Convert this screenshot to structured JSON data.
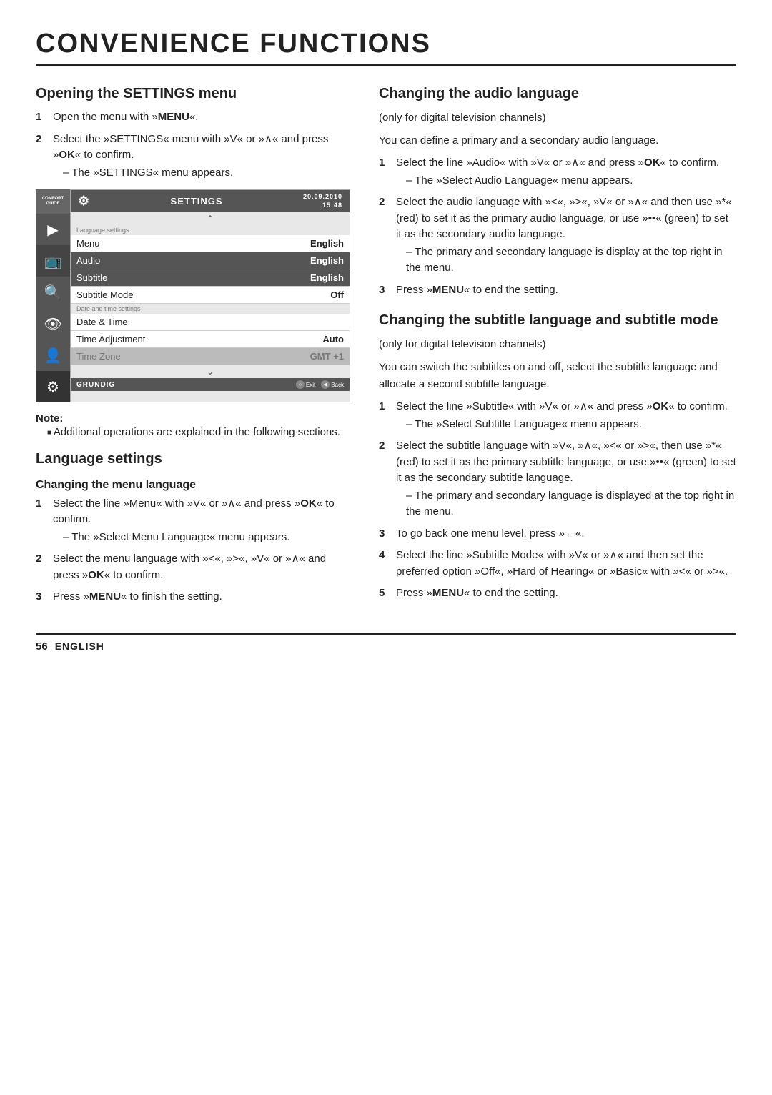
{
  "page": {
    "title": "CONVENIENCE FUNCTIONS",
    "footer": {
      "page_number": "56",
      "language": "ENGLISH"
    }
  },
  "left_column": {
    "opening_settings": {
      "title": "Opening the SETTINGS menu",
      "steps": [
        {
          "num": "1",
          "text": "Open the menu with »MENU«."
        },
        {
          "num": "2",
          "text": "Select the »SETTINGS« menu with »V« or »∧« and press »OK« to confirm.",
          "sub": "– The »SETTINGS« menu appears."
        }
      ]
    },
    "menu_sim": {
      "header_title": "SETTINGS",
      "date": "20.09.2010",
      "time": "15:48",
      "section_language": "Language settings",
      "rows_language": [
        {
          "label": "Menu",
          "value": "English",
          "highlighted": false
        },
        {
          "label": "Audio",
          "value": "English",
          "highlighted": true
        },
        {
          "label": "Subtitle",
          "value": "English",
          "highlighted": true
        },
        {
          "label": "Subtitle Mode",
          "value": "Off",
          "highlighted": false
        }
      ],
      "section_datetime": "Date and time settings",
      "rows_datetime": [
        {
          "label": "Date & Time",
          "value": "",
          "highlighted": false
        },
        {
          "label": "Time Adjustment",
          "value": "Auto",
          "highlighted": false
        },
        {
          "label": "Time Zone",
          "value": "GMT +1",
          "highlighted": false
        }
      ],
      "footer_logo": "GRUNDIG",
      "footer_exit": "Exit",
      "footer_back": "Back"
    },
    "note": {
      "title": "Note:",
      "items": [
        "Additional operations are explained in the following sections."
      ]
    },
    "language_settings": {
      "title": "Language settings"
    },
    "changing_menu": {
      "title": "Changing the menu language",
      "steps": [
        {
          "num": "1",
          "text": "Select the line »Menu« with »V« or »∧« and press »OK« to confirm.",
          "sub": "– The »Select Menu Language« menu appears."
        },
        {
          "num": "2",
          "text": "Select the menu language with »<«, »>«, »V« or »∧« and press »OK« to confirm."
        },
        {
          "num": "3",
          "text": "Press »MENU« to finish the setting."
        }
      ]
    }
  },
  "right_column": {
    "changing_audio": {
      "title": "Changing the audio language",
      "subtitle_note": "(only for digital television channels)",
      "intro": "You can define a primary and a secondary audio language.",
      "steps": [
        {
          "num": "1",
          "text": "Select the line »Audio« with »V« or »∧« and press »OK« to confirm.",
          "sub": "– The »Select Audio Language« menu appears."
        },
        {
          "num": "2",
          "text": "Select the audio language with »<«, »>«, »V« or »∧« and then use »*« (red) to set it as the primary audio language, or use »••«  (green) to set it as the secondary audio language.",
          "sub": "– The primary and secondary language is display at the top right in the menu."
        },
        {
          "num": "3",
          "text": "Press »MENU« to end the setting."
        }
      ]
    },
    "changing_subtitle": {
      "title": "Changing the subtitle language and subtitle mode",
      "subtitle_note": "(only for digital television channels)",
      "intro": "You can switch the subtitles on and off, select the subtitle language and allocate a second subtitle language.",
      "steps": [
        {
          "num": "1",
          "text": "Select the line »Subtitle« with »V« or »∧« and press »OK« to confirm.",
          "sub": "– The »Select Subtitle Language« menu appears."
        },
        {
          "num": "2",
          "text": "Select the subtitle language with »V«, »∧«, »<« or »>«, then use »*« (red) to set it as the primary subtitle language, or use »••« (green) to set it as the secondary subtitle language.",
          "sub": "– The primary and secondary language is displayed at the top right in the menu."
        },
        {
          "num": "3",
          "text": "To go back one menu level, press »←«."
        },
        {
          "num": "4",
          "text": "Select the line »Subtitle Mode« with »V« or »∧« and then set the preferred option »Off«, »Hard of Hearing« or »Basic« with »<« or »>«."
        },
        {
          "num": "5",
          "text": "Press »MENU« to end the setting."
        }
      ]
    }
  }
}
